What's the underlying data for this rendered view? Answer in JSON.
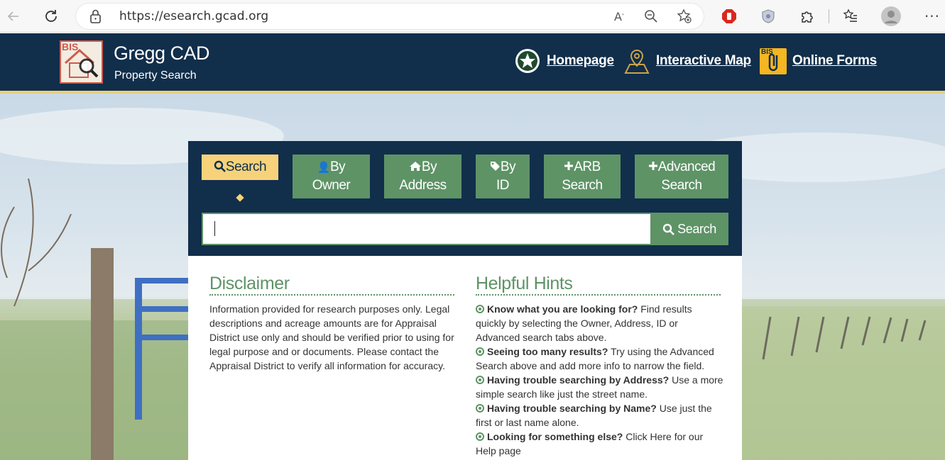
{
  "browser": {
    "url": "https://esearch.gcad.org"
  },
  "header": {
    "title": "Gregg CAD",
    "subtitle": "Property Search",
    "logo_text": "BIS",
    "nav": [
      {
        "label": "Homepage"
      },
      {
        "label": "Interactive Map"
      },
      {
        "label": "Online Forms"
      }
    ],
    "forms_badge": "BIS"
  },
  "tabs": [
    {
      "label": "Search"
    },
    {
      "label_line1": "By",
      "label_line2": "Owner"
    },
    {
      "label_line1": "By",
      "label_line2": "Address"
    },
    {
      "label_line1": "By",
      "label_line2": "ID"
    },
    {
      "label_line1": "ARB",
      "label_line2": "Search"
    },
    {
      "label_line1": "Advanced",
      "label_line2": "Search"
    }
  ],
  "search": {
    "value": "",
    "button_label": "Search"
  },
  "disclaimer": {
    "title": "Disclaimer",
    "text": "Information provided for research purposes only. Legal descriptions and acreage amounts are for Appraisal District use only and should be verified prior to using for legal purpose and or documents. Please contact the Appraisal District to verify all information for accuracy."
  },
  "hints": {
    "title": "Helpful Hints",
    "items": [
      {
        "bold": "Know what you are looking for?",
        "text": " Find results quickly by selecting the Owner, Address, ID or Advanced search tabs above."
      },
      {
        "bold": "Seeing too many results?",
        "text": " Try using the Advanced Search above and add more info to narrow the field."
      },
      {
        "bold": "Having trouble searching by Address?",
        "text": " Use a more simple search like just the street name."
      },
      {
        "bold": "Having trouble searching by Name?",
        "text": " Use just the first or last name alone."
      },
      {
        "bold": "Looking for something else?",
        "text": " Click Here for our Help page"
      }
    ]
  },
  "colors": {
    "navy": "#112e4b",
    "green": "#5e9366",
    "gold": "#f6d27a"
  }
}
